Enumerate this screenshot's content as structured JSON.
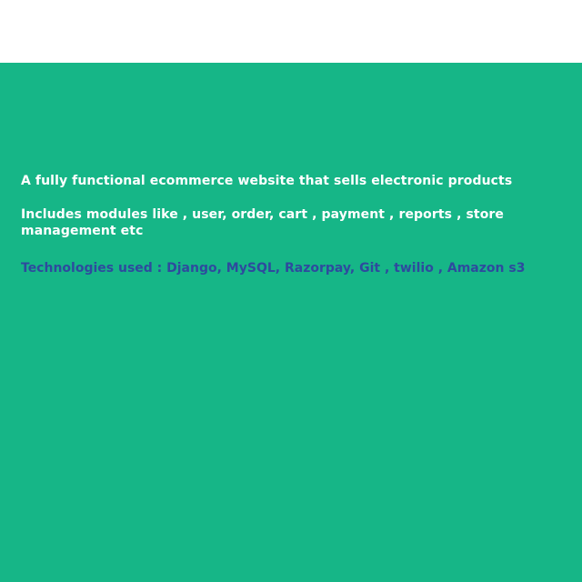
{
  "project": {
    "description": "A fully functional ecommerce website that sells electronic products",
    "modules": "Includes modules like , user, order, cart , payment , reports , store management etc",
    "technologies": "Technologies used : Django, MySQL, Razorpay, Git , twilio , Amazon s3"
  },
  "colors": {
    "panel_background": "#16b687",
    "primary_text": "#ffffff",
    "accent_text": "#2e4a9e"
  }
}
